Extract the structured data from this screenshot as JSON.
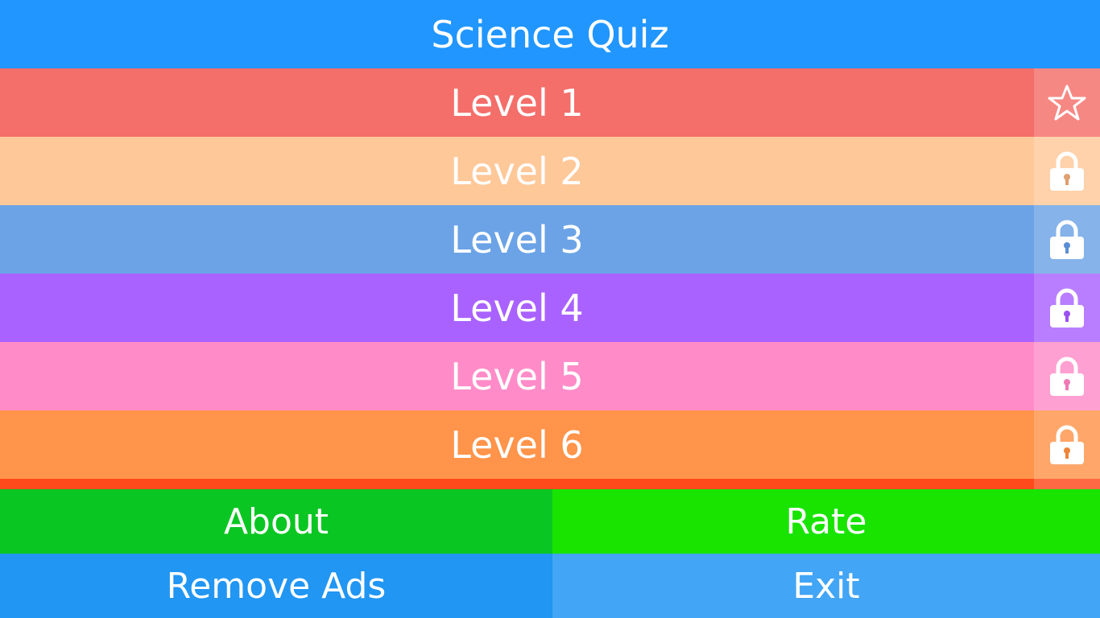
{
  "header": {
    "title": "Science Quiz",
    "color": "#2196FF"
  },
  "levels": [
    {
      "label": "Level 1",
      "color": "#F46E6A",
      "status": "unlocked",
      "icon": "star-icon"
    },
    {
      "label": "Level 2",
      "color": "#FFC899",
      "status": "locked",
      "icon": "lock-icon"
    },
    {
      "label": "Level 3",
      "color": "#6BA3E6",
      "status": "locked",
      "icon": "lock-icon"
    },
    {
      "label": "Level 4",
      "color": "#A962FF",
      "status": "locked",
      "icon": "lock-icon"
    },
    {
      "label": "Level 5",
      "color": "#FF8CC8",
      "status": "locked",
      "icon": "lock-icon"
    },
    {
      "label": "Level 6",
      "color": "#FF944A",
      "status": "locked",
      "icon": "lock-icon"
    }
  ],
  "next_level_color": "#FF4A1C",
  "menu": {
    "about": {
      "label": "About",
      "color": "#0AC623"
    },
    "rate": {
      "label": "Rate",
      "color": "#18E400"
    },
    "remove_ads": {
      "label": "Remove Ads",
      "color": "#2196F3"
    },
    "exit": {
      "label": "Exit",
      "color": "#42A5F5"
    }
  }
}
